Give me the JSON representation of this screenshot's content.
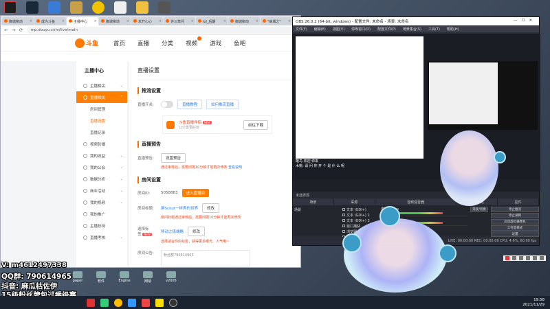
{
  "browser": {
    "tabs": [
      {
        "label": "御城柳动"
      },
      {
        "label": "成为斗鱼"
      },
      {
        "label": "主播中心"
      },
      {
        "label": "御城柳动"
      },
      {
        "label": "未开心心"
      },
      {
        "label": "许三草月"
      },
      {
        "label": "lol_后期"
      },
      {
        "label": "御城柳动"
      },
      {
        "label": "\"病城之\""
      }
    ],
    "url": "mp.douyu.com/live/main"
  },
  "site": {
    "logo_text": "斗鱼",
    "nav": [
      "首页",
      "直播",
      "分类",
      "视频",
      "游戏",
      "鱼吧"
    ]
  },
  "sidebar": {
    "title": "主播中心",
    "items": [
      {
        "label": "主播相关"
      },
      {
        "label": "直播相关"
      },
      {
        "label": "房间管理"
      },
      {
        "label": "直播设置"
      },
      {
        "label": "直播记录"
      },
      {
        "label": "视频轮播"
      },
      {
        "label": "我的收益"
      },
      {
        "label": "我的公会"
      },
      {
        "label": "数据分析"
      },
      {
        "label": "商业活动"
      },
      {
        "label": "我的视频"
      },
      {
        "label": "我的推广"
      },
      {
        "label": "主播扶持"
      },
      {
        "label": "直播考核"
      }
    ]
  },
  "content": {
    "title": "直播设置",
    "stream": {
      "heading": "推流设置",
      "label": "直播开关:",
      "btn_tutorial": "直播教程",
      "btn_tool": "如何推流直播",
      "promo_title": "斗鱼直播伴侣",
      "promo_sub": "让公告更好玩",
      "promo_badge": "NEW",
      "promo_btn": "前往下载"
    },
    "preview": {
      "heading": "直播预告",
      "label": "直播预告:",
      "btn": "设置预告",
      "hint": "通过审核后，需要间隔10分钟才能再次修改",
      "hint_link": "查看说明"
    },
    "room": {
      "heading": "房间设置",
      "id_label": "房间ID:",
      "id_value": "5058883",
      "id_btn": "进入直播间",
      "title_label": "房间标题:",
      "title_value": "屏Scout一样秀的世界",
      "title_btn": "修改",
      "title_hint": "房间标题通过审核后，需要间隔10分钟才能再次修改",
      "cat_label": "选择标签:",
      "cat_badge": "NEW",
      "cat_value": "移动之极端略",
      "cat_btn": "修改",
      "cat_hint": "选择适合你的标签，获得更多曝光、人气哦~",
      "notice_label": "房间公告:",
      "notice_value": "粉丝群790614965"
    }
  },
  "obs": {
    "title": "OBS 26.0.2 (64-bit, windows) - 配置文件: 未命名 - 场景: 未命名",
    "menu": [
      "文件(F)",
      "编辑(E)",
      "视图(V)",
      "停靠窗口(D)",
      "配置文件(P)",
      "场景集合(S)",
      "工具(T)",
      "帮助(H)"
    ],
    "source_label": "未选择源",
    "panels": [
      "场景",
      "来源",
      "音频混音器",
      "转场特效",
      "控件"
    ],
    "scenes": [
      "场景"
    ],
    "sources": [
      "文本 (GDI+)",
      "文本 (GDI+) 2",
      "文本 (GDI+) 3",
      "窗口捕获",
      "浏览器 2",
      "图像"
    ],
    "mixer": [
      {
        "name": "麦克风/Aux"
      },
      {
        "name": "桌面音频"
      }
    ],
    "transition": "渐变/切换",
    "controls": [
      "停止推流",
      "停止录制",
      "启动虚拟摄像机",
      "工作室模式",
      "设置",
      "退出"
    ],
    "status": "LIVE: 00:00:00   REC: 00:00:00   CPU: 4.6%, 60.00 fps",
    "chat": [
      "酷鸟 欢迎 你来",
      "木桃: 请 问 你 开 个 是 什 么 呢"
    ]
  },
  "overlay": {
    "line1": "V: m4612497338",
    "line2": "QQ群: 790614965",
    "line3": "抖音: 麻瓜枯佐伊",
    "line4": "15级粉丝牌包过番级赛"
  },
  "desktop_icons": [
    "paper",
    "软件",
    "Engine",
    "网易",
    "v2005"
  ],
  "clock": {
    "time": "19:58",
    "date": "2021/11/29"
  }
}
